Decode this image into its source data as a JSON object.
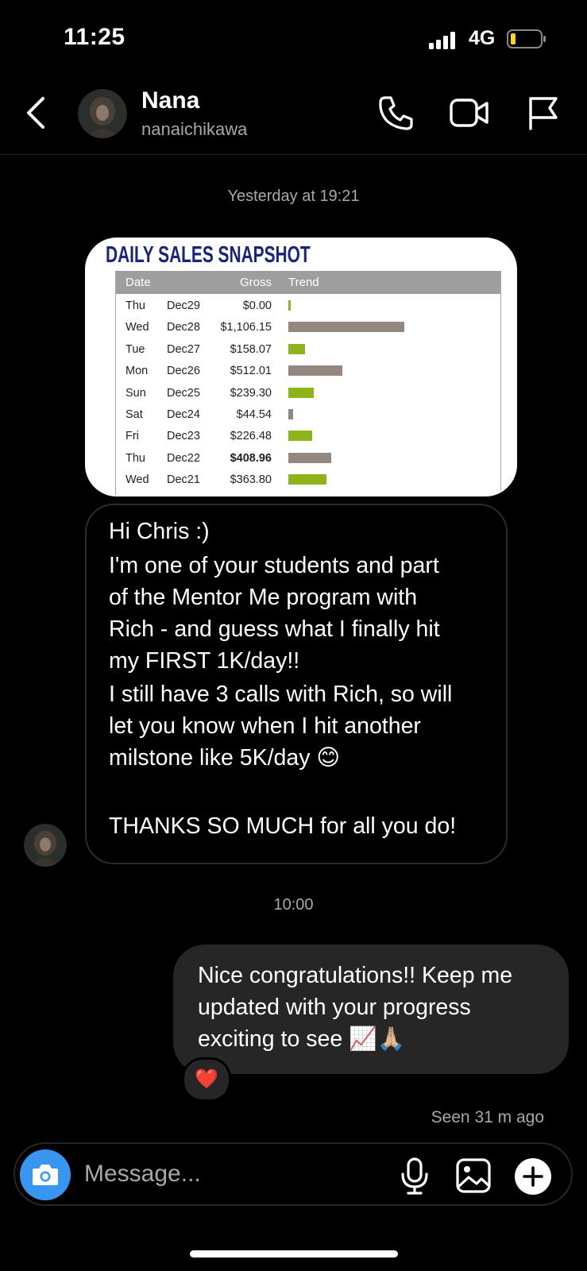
{
  "status_bar": {
    "time": "11:25",
    "network": "4G"
  },
  "header": {
    "name": "Nana",
    "username": "nanaichikawa"
  },
  "timestamps": {
    "first": "Yesterday at 19:21",
    "second": "10:00"
  },
  "sales_image": {
    "title": "DAILY SALES SNAPSHOT",
    "columns": [
      "Date",
      "Gross",
      "Trend"
    ],
    "rows": [
      {
        "day": "Thu",
        "date": "Dec29",
        "gross": "$0.00",
        "trend": 0.0,
        "color": "#8fb31a"
      },
      {
        "day": "Wed",
        "date": "Dec28",
        "gross": "$1,106.15",
        "trend": 1106.15,
        "color": "#93877f"
      },
      {
        "day": "Tue",
        "date": "Dec27",
        "gross": "$158.07",
        "trend": 158.07,
        "color": "#8fb31a"
      },
      {
        "day": "Mon",
        "date": "Dec26",
        "gross": "$512.01",
        "trend": 512.01,
        "color": "#93877f"
      },
      {
        "day": "Sun",
        "date": "Dec25",
        "gross": "$239.30",
        "trend": 239.3,
        "color": "#8fb31a"
      },
      {
        "day": "Sat",
        "date": "Dec24",
        "gross": "$44.54",
        "trend": 44.54,
        "color": "#93877f"
      },
      {
        "day": "Fri",
        "date": "Dec23",
        "gross": "$226.48",
        "trend": 226.48,
        "color": "#8fb31a"
      },
      {
        "day": "Thu",
        "date": "Dec22",
        "gross": "$408.96",
        "trend": 408.96,
        "color": "#93877f"
      },
      {
        "day": "Wed",
        "date": "Dec21",
        "gross": "$363.80",
        "trend": 363.8,
        "color": "#8fb31a"
      }
    ]
  },
  "incoming_message": {
    "lines": [
      "Hi Chris :)",
      "I'm one of your students and part",
      "of the Mentor Me program with",
      "Rich - and guess what I finally hit",
      "my FIRST 1K/day!!",
      "I still have 3 calls with Rich, so will",
      "let you know when I hit another",
      "milstone like 5K/day 😊",
      "",
      "THANKS SO MUCH for all you do!"
    ]
  },
  "outgoing_message": {
    "lines": [
      "Nice congratulations!! Keep me",
      "updated with your progress",
      "exciting to see 📈🙏🏼"
    ],
    "reaction": "❤️"
  },
  "seen_status": "Seen 31 m ago",
  "composer": {
    "placeholder": "Message..."
  },
  "colors": {
    "accent": "#3797f0",
    "bubble_out": "#262626",
    "chart_title": "#1a237e"
  }
}
